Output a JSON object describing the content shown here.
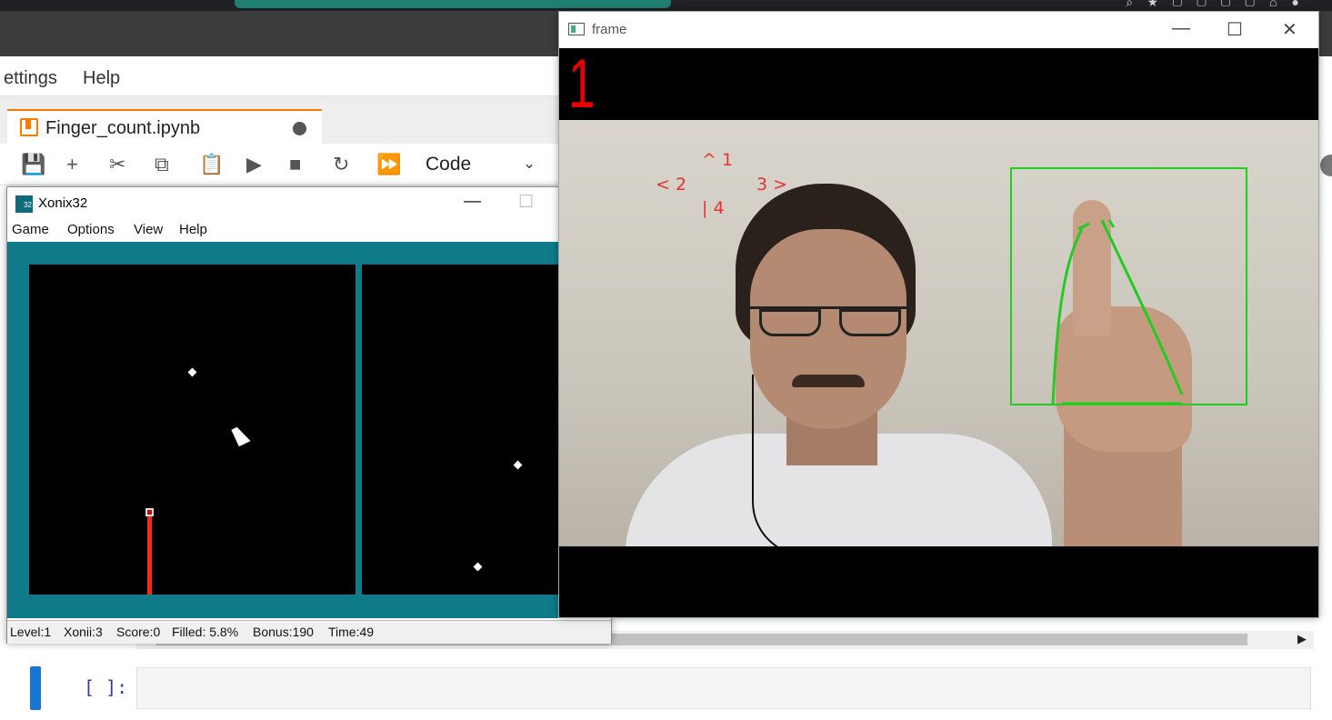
{
  "jupyter": {
    "menu": [
      "ettings",
      "Help"
    ],
    "notebook_tab": {
      "title": "Finger_count.ipynb"
    },
    "toolbar": {
      "cell_type": "Code"
    },
    "cell": {
      "prompt": "[ ]:"
    }
  },
  "xonix": {
    "title": "Xonix32",
    "menu": [
      "Game",
      "Options",
      "View",
      "Help"
    ],
    "status": {
      "level": "Level:1",
      "xonii": "Xonii:3",
      "score": "Score:0",
      "filled": "Filled: 5.8%",
      "bonus": "Bonus:190",
      "time": "Time:49"
    },
    "colors": {
      "field_border": "#0f7b88",
      "trail": "#ff2a14"
    }
  },
  "frame": {
    "title": "frame",
    "finger_count": "1",
    "directions": {
      "up": "^ 1",
      "left": "< 2",
      "right": "3 >",
      "down": "| 4"
    },
    "colors": {
      "count_text": "#e60000",
      "roi_box": "#22cc22"
    }
  }
}
